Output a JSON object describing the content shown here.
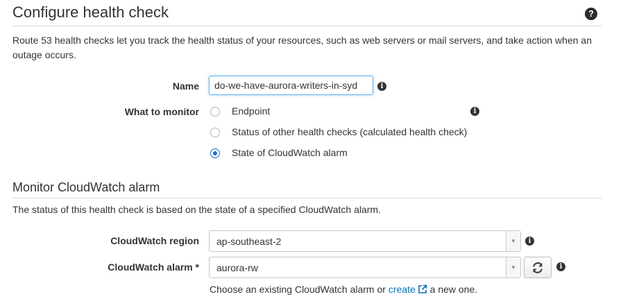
{
  "header": {
    "title": "Configure health check",
    "help_icon": "question-circle-icon"
  },
  "intro": "Route 53 health checks let you track the health status of your resources, such as web servers or mail servers, and take action when an outage occurs.",
  "form": {
    "name_label": "Name",
    "name_value": "do-we-have-aurora-writers-in-syd",
    "monitor_label": "What to monitor",
    "monitor_options": [
      {
        "label": "Endpoint",
        "checked": false
      },
      {
        "label": "Status of other health checks (calculated health check)",
        "checked": false
      },
      {
        "label": "State of CloudWatch alarm",
        "checked": true
      }
    ]
  },
  "alarm_section": {
    "title": "Monitor CloudWatch alarm",
    "description": "The status of this health check is based on the state of a specified CloudWatch alarm.",
    "region_label": "CloudWatch region",
    "region_value": "ap-southeast-2",
    "alarm_label": "CloudWatch alarm *",
    "alarm_value": "aurora-rw",
    "hint_prefix": "Choose an existing CloudWatch alarm or",
    "hint_link": "create",
    "hint_suffix": "a new one."
  },
  "colors": {
    "accent": "#1a6ecf",
    "link": "#0073bb",
    "focus_border": "#66afe9"
  },
  "icons": {
    "info": "info-icon",
    "refresh": "refresh-icon",
    "external_link": "external-link-icon",
    "caret": "caret-down-icon"
  }
}
